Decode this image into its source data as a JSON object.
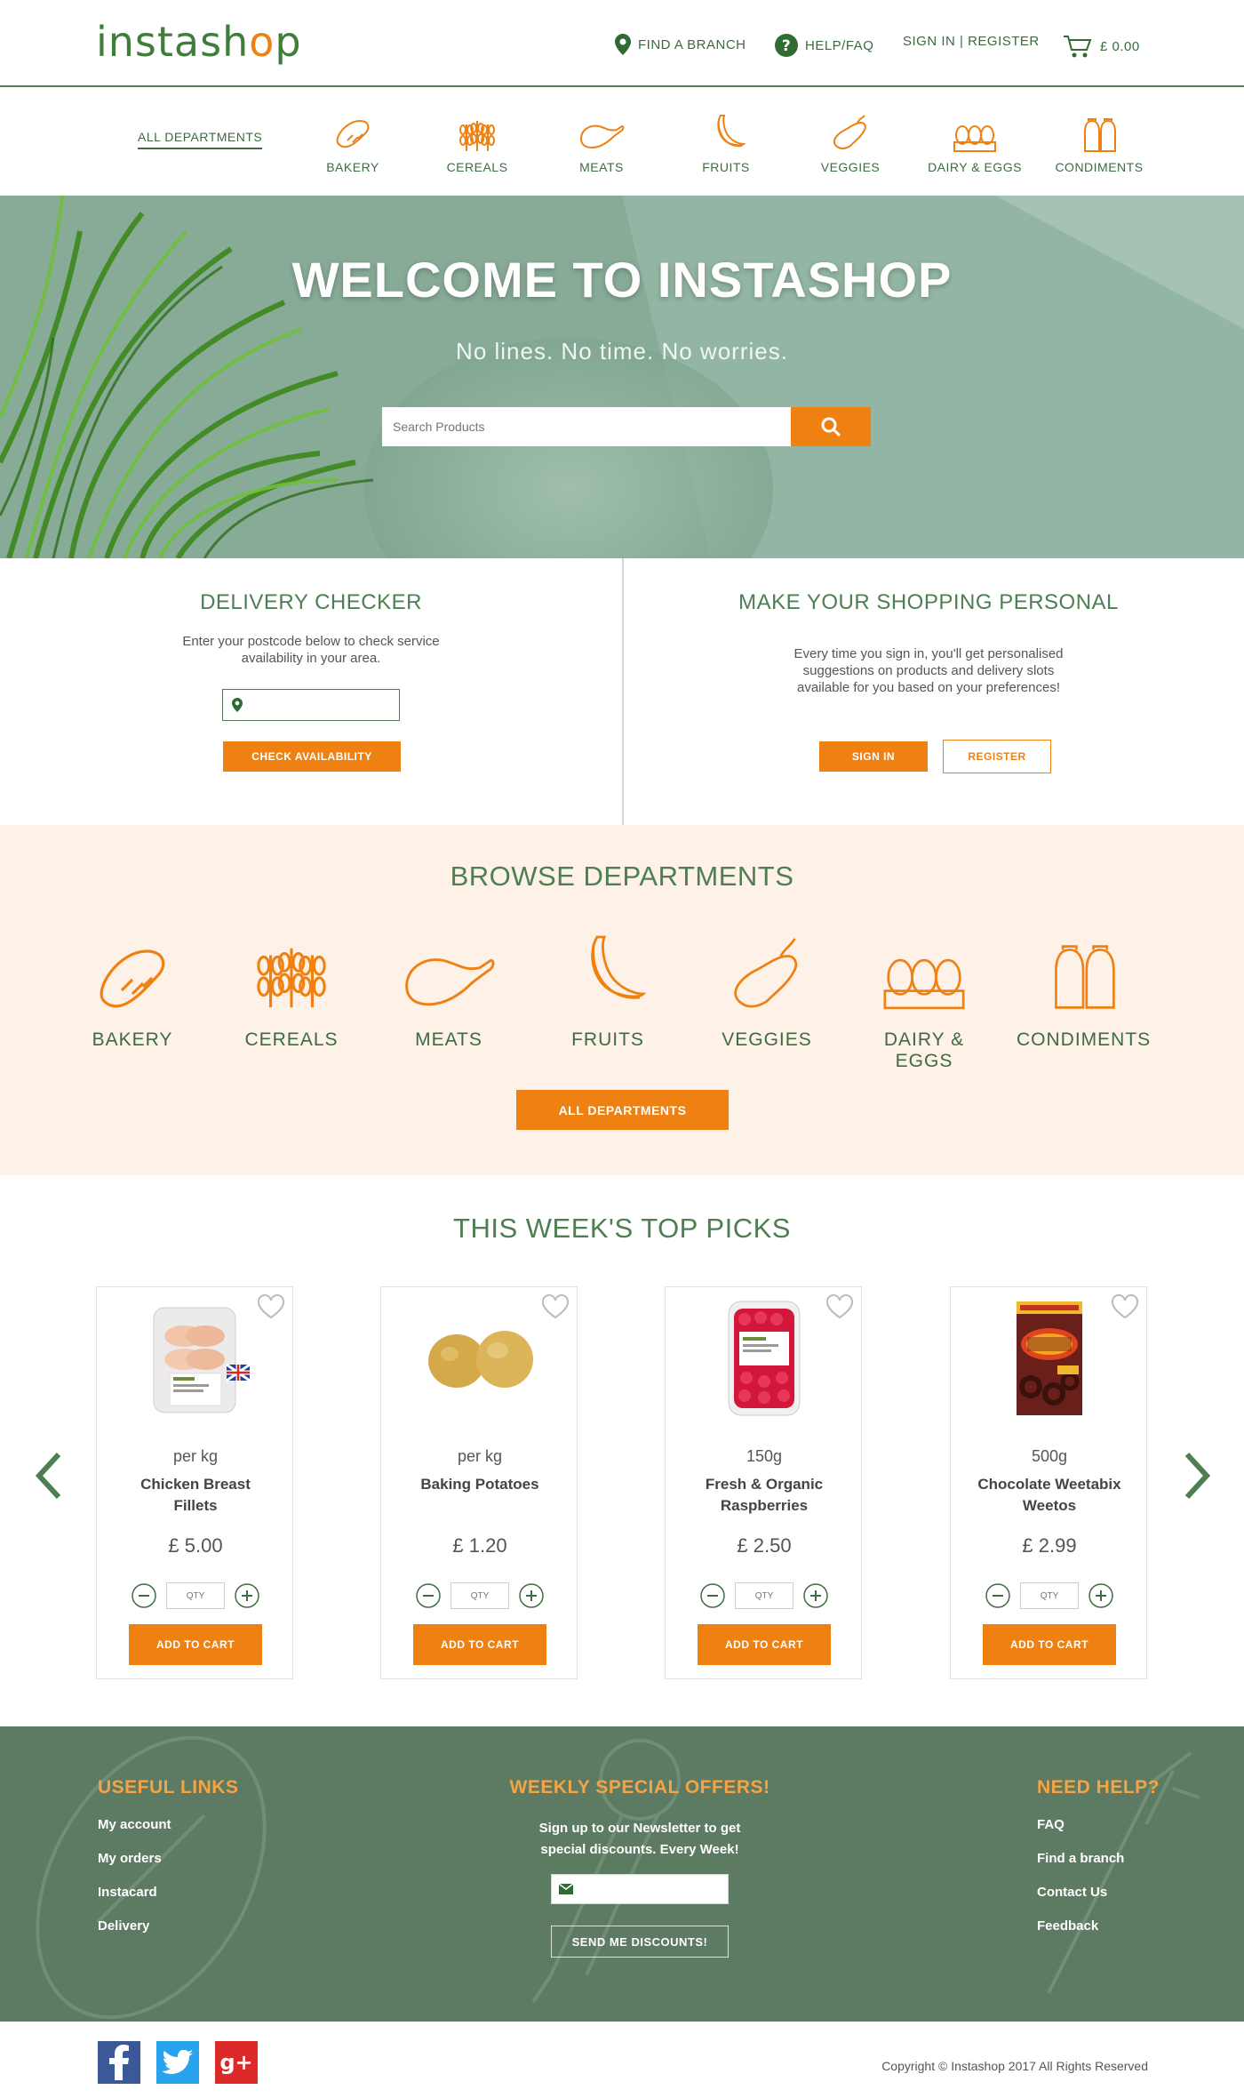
{
  "header": {
    "logo_prefix": "instash",
    "logo_o": "o",
    "logo_suffix": "p",
    "find_branch": "FIND A BRANCH",
    "help": "HELP/FAQ",
    "sign_in": "SIGN IN | REGISTER",
    "cart_total": "£ 0.00"
  },
  "nav": {
    "all": "ALL DEPARTMENTS",
    "items": [
      {
        "label": "BAKERY",
        "icon": "bread-icon"
      },
      {
        "label": "CEREALS",
        "icon": "wheat-icon"
      },
      {
        "label": "MEATS",
        "icon": "chicken-leg-icon"
      },
      {
        "label": "FRUITS",
        "icon": "banana-icon"
      },
      {
        "label": "VEGGIES",
        "icon": "eggplant-icon"
      },
      {
        "label": "DAIRY & EGGS",
        "icon": "eggs-icon"
      },
      {
        "label": "CONDIMENTS",
        "icon": "salt-pepper-icon"
      }
    ]
  },
  "hero": {
    "title": "WELCOME TO INSTASHOP",
    "subtitle": "No lines. No time. No worries.",
    "search_placeholder": "Search Products"
  },
  "delivery": {
    "title": "DELIVERY CHECKER",
    "text_line1": "Enter your postcode below to check service",
    "text_line2": "availability in your area.",
    "button": "CHECK AVAILABILITY"
  },
  "personal": {
    "title": "MAKE YOUR SHOPPING PERSONAL",
    "text_line1": "Every time you sign in, you'll get personalised",
    "text_line2": "suggestions on products and delivery slots",
    "text_line3": "available for you based on your preferences!",
    "sign_in": "SIGN IN",
    "register": "REGISTER"
  },
  "browse": {
    "title": "BROWSE DEPARTMENTS",
    "items": [
      {
        "label": "BAKERY"
      },
      {
        "label": "CEREALS"
      },
      {
        "label": "MEATS"
      },
      {
        "label": "FRUITS"
      },
      {
        "label": "VEGGIES"
      },
      {
        "label": "DAIRY & EGGS"
      },
      {
        "label": "CONDIMENTS"
      }
    ],
    "button": "ALL DEPARTMENTS"
  },
  "top_picks": {
    "title": "THIS WEEK'S TOP PICKS",
    "qty_placeholder": "QTY",
    "add_label": "ADD TO CART",
    "products": [
      {
        "unit": "per kg",
        "name_line1": "Chicken Breast",
        "name_line2": "Fillets",
        "price": "£ 5.00"
      },
      {
        "unit": "per kg",
        "name_line1": "Baking Potatoes",
        "name_line2": "",
        "price": "£ 1.20"
      },
      {
        "unit": "150g",
        "name_line1": "Fresh & Organic",
        "name_line2": "Raspberries",
        "price": "£ 2.50"
      },
      {
        "unit": "500g",
        "name_line1": "Chocolate Weetabix",
        "name_line2": "Weetos",
        "price": "£ 2.99"
      }
    ]
  },
  "footer": {
    "useful_title": "USEFUL LINKS",
    "useful_links": [
      "My account",
      "My orders",
      "Instacard",
      "Delivery"
    ],
    "offers_title": "WEEKLY SPECIAL OFFERS!",
    "offers_line1": "Sign up to our Newsletter to get",
    "offers_line2": "special discounts. Every Week!",
    "offers_button": "SEND ME DISCOUNTS!",
    "help_title": "NEED HELP?",
    "help_links": [
      "FAQ",
      "Find a branch",
      "Contact Us",
      "Feedback"
    ]
  },
  "bottom": {
    "social": [
      "facebook-icon",
      "twitter-icon",
      "google-plus-icon"
    ],
    "copyright": "Copyright © Instashop 2017 All Rights Reserved"
  },
  "colors": {
    "brand_green": "#3e7d3a",
    "accent_orange": "#ef8113",
    "footer_green": "#5d7a62",
    "browse_bg": "#fdf1e8"
  }
}
